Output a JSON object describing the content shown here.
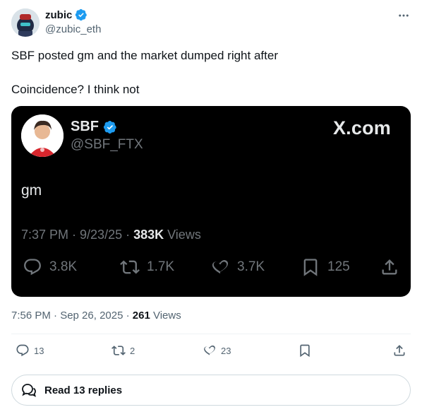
{
  "author": {
    "display_name": "zubic",
    "handle": "@zubic_eth"
  },
  "tweet": {
    "line1": "SBF posted gm and the market dumped right after",
    "line2": "Coincidence? I think not"
  },
  "embedded": {
    "display_name": "SBF",
    "handle": "@SBF_FTX",
    "brand": "X.com",
    "text": "gm",
    "time": "7:37 PM · 9/23/25 · ",
    "views_count": "383K",
    "views_label": " Views",
    "replies": "3.8K",
    "reposts": "1.7K",
    "likes": "3.7K",
    "bookmarks": "125"
  },
  "meta": {
    "time": "7:56 PM · Sep 26, 2025 · ",
    "views_count": "261",
    "views_label": " Views"
  },
  "actions": {
    "replies": "13",
    "reposts": "2",
    "likes": "23"
  },
  "replies_button": {
    "label": "Read 13 replies"
  },
  "colors": {
    "verified": "#1d9bf0",
    "secondary_text": "#536471",
    "card_bg": "#000000"
  },
  "icons": [
    "more-icon",
    "verified-icon",
    "reply-icon",
    "repost-icon",
    "like-icon",
    "bookmark-icon",
    "share-icon",
    "chat-bubbles-icon"
  ]
}
